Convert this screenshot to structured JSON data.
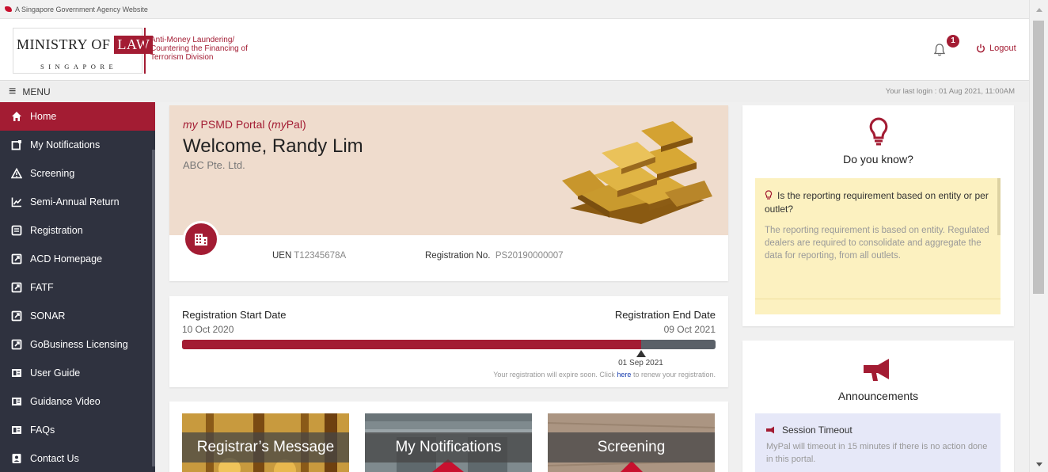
{
  "gov_bar": {
    "text": "A Singapore Government Agency Website"
  },
  "header": {
    "logo_ministry": "MINISTRY OF",
    "logo_law": "LAW",
    "logo_country": "SINGAPORE",
    "division_line1": "Anti-Money Laundering/",
    "division_line2": "Countering the Financing of",
    "division_line3": "Terrorism Division",
    "notification_count": "1",
    "logout_label": "Logout"
  },
  "menu_bar": {
    "menu_label": "MENU",
    "last_login": "Your last login : 01 Aug 2021, 11:00AM"
  },
  "sidebar": {
    "items": [
      {
        "label": "Home",
        "icon": "home-icon",
        "active": true
      },
      {
        "label": "My Notifications",
        "icon": "notifications-icon"
      },
      {
        "label": "Screening",
        "icon": "warning-icon"
      },
      {
        "label": "Semi-Annual Return",
        "icon": "chart-icon"
      },
      {
        "label": "Registration",
        "icon": "registration-icon"
      },
      {
        "label": "ACD Homepage",
        "icon": "external-link-icon"
      },
      {
        "label": "FATF",
        "icon": "external-link-icon"
      },
      {
        "label": "SONAR",
        "icon": "external-link-icon"
      },
      {
        "label": "GoBusiness Licensing",
        "icon": "external-link-icon"
      },
      {
        "label": "User Guide",
        "icon": "book-icon"
      },
      {
        "label": "Guidance Video",
        "icon": "book-icon"
      },
      {
        "label": "FAQs",
        "icon": "book-icon"
      },
      {
        "label": "Contact Us",
        "icon": "contact-icon"
      }
    ]
  },
  "welcome": {
    "portal_my1": "my",
    "portal_mid": " PSMD Portal (",
    "portal_my2": "my",
    "portal_end": "Pal)",
    "greeting": "Welcome, Randy Lim",
    "company": "ABC Pte. Ltd.",
    "uen_label": "UEN",
    "uen_value": "T12345678A",
    "regno_label": "Registration No.",
    "regno_value": "PS20190000007"
  },
  "registration": {
    "start_label": "Registration Start Date",
    "start_date": "10 Oct 2020",
    "end_label": "Registration End Date",
    "end_date": "09 Oct 2021",
    "progress_fraction": 0.86,
    "marker_date": "01 Sep 2021",
    "note_before": "Your registration will expire soon. Click ",
    "note_link": "here",
    "note_after": " to renew your registration."
  },
  "tiles": [
    {
      "label": "Registrar’s Message"
    },
    {
      "label": "My Notifications"
    },
    {
      "label": "Screening"
    }
  ],
  "do_you_know": {
    "title": "Do you know?",
    "question": "Is the reporting requirement based on entity or per outlet?",
    "answer": "The reporting requirement is based on entity. Regulated dealers are required to consolidate and aggregate the data for reporting, from all outlets."
  },
  "announcements": {
    "title": "Announcements",
    "item_title": "Session Timeout",
    "item_text": "MyPal will timeout in 15 minutes if there is no action done in this portal."
  },
  "colors": {
    "accent": "#a31c33",
    "sidebar_bg": "#2f323f",
    "welcome_bg": "#efdccd",
    "tip_bg": "#fcf1c0",
    "announcement_bg": "#e6e8f8"
  }
}
